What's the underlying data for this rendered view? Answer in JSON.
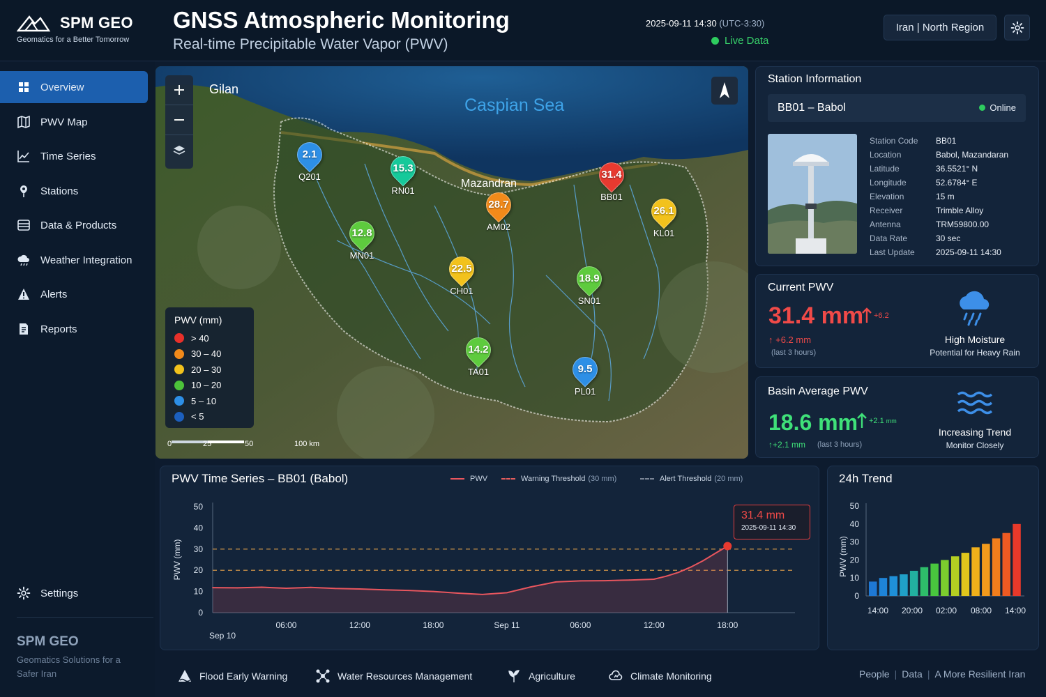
{
  "header": {
    "brand": "SPM GEO",
    "brand_tagline": "Geomatics for a Better Tomorrow",
    "title": "GNSS Atmospheric Monitoring",
    "subtitle": "Real-time Precipitable Water Vapor (PWV)",
    "datetime": "2025-09-11 14:30",
    "timezone": "(UTC-3:30)",
    "live_label": "Live Data",
    "region": "Iran | North Region",
    "settings_icon": "gear-icon"
  },
  "sidebar": {
    "items": [
      {
        "label": "Overview",
        "icon": "overview-icon",
        "active": true
      },
      {
        "label": "PWV Map",
        "icon": "map-icon"
      },
      {
        "label": "Time Series",
        "icon": "chart-line-icon"
      },
      {
        "label": "Stations",
        "icon": "pin-icon"
      },
      {
        "label": "Data & Products",
        "icon": "database-icon"
      },
      {
        "label": "Weather Integration",
        "icon": "cloud-icon"
      },
      {
        "label": "Alerts",
        "icon": "alert-icon"
      },
      {
        "label": "Reports",
        "icon": "report-icon"
      }
    ],
    "settings_label": "Settings",
    "footer_brand": "SPM GEO",
    "footer_text": "Geomatics Solutions for a Safer Iran"
  },
  "map": {
    "labels": {
      "sea": "Caspian Sea",
      "gilan": "Gilan",
      "mazandaran": "Mazandran"
    },
    "stations": [
      {
        "code": "Q201",
        "pwv": "2.1",
        "color": "#2d8fe6"
      },
      {
        "code": "RN01",
        "pwv": "15.3",
        "color": "#16c99a"
      },
      {
        "code": "AM02",
        "pwv": "28.7",
        "color": "#f28a1a"
      },
      {
        "code": "BB01",
        "pwv": "31.4",
        "color": "#e83a30"
      },
      {
        "code": "KL01",
        "pwv": "26.1",
        "color": "#f2c21c"
      },
      {
        "code": "MN01",
        "pwv": "12.8",
        "color": "#5ecb3e"
      },
      {
        "code": "CH01",
        "pwv": "22.5",
        "color": "#f2c21c"
      },
      {
        "code": "SN01",
        "pwv": "18.9",
        "color": "#5ecb3e"
      },
      {
        "code": "TA01",
        "pwv": "14.2",
        "color": "#5ecb3e"
      },
      {
        "code": "PL01",
        "pwv": "9.5",
        "color": "#2d8fe6"
      }
    ],
    "legend": {
      "title": "PWV (mm)",
      "rows": [
        {
          "label": "> 40",
          "color": "#e8302a"
        },
        {
          "label": "30 – 40",
          "color": "#f28a1a"
        },
        {
          "label": "20 – 30",
          "color": "#f2c21c"
        },
        {
          "label": "10 – 20",
          "color": "#4cc23a"
        },
        {
          "label": "5 – 10",
          "color": "#2d8fe6"
        },
        {
          "label": "< 5",
          "color": "#1c5fbd"
        }
      ]
    },
    "scale": {
      "s0": "0",
      "s1": "25",
      "s2": "50",
      "s3": "100 km"
    }
  },
  "station_info": {
    "title": "Station Information",
    "selected": "BB01 – Babol",
    "status": "Online",
    "rows": [
      {
        "k": "Station Code",
        "v": "BB01"
      },
      {
        "k": "Location",
        "v": "Babol, Mazandaran"
      },
      {
        "k": "Latitude",
        "v": "36.5521° N"
      },
      {
        "k": "Longitude",
        "v": "52.6784° E"
      },
      {
        "k": "Elevation",
        "v": "15 m"
      },
      {
        "k": "Receiver",
        "v": "Trimble Alloy"
      },
      {
        "k": "Antenna",
        "v": "TRM59800.00"
      },
      {
        "k": "Data Rate",
        "v": "30 sec"
      },
      {
        "k": "Last Update",
        "v": "2025-09-11 14:30"
      }
    ]
  },
  "current_pwv": {
    "title": "Current PWV",
    "value": "31.4 mm",
    "delta_small": "+6.2",
    "delta": "+6.2 mm",
    "delta_note": "(last 3 hours)",
    "status": "High Moisture",
    "status_note": "Potential for Heavy Rain"
  },
  "basin_pwv": {
    "title": "Basin Average PWV",
    "value": "18.6 mm",
    "delta_small": "+2.1",
    "delta_unit": "mm",
    "delta": "+2.1 mm",
    "delta_note": "(last 3 hours)",
    "status": "Increasing Trend",
    "status_note": "Monitor Closely"
  },
  "time_series": {
    "title": "PWV Time Series – BB01 (Babol)",
    "legend": {
      "pwv": "PWV",
      "warning": "Warning Threshold",
      "warning_val": "(30 mm)",
      "alert": "Alert Threshold",
      "alert_val": "(20 mm)"
    },
    "tooltip_value": "31.4 mm",
    "tooltip_time": "2025-09-11 14:30"
  },
  "chart_data": [
    {
      "type": "line",
      "title": "PWV Time Series – BB01 (Babol)",
      "ylabel": "PWV (mm)",
      "xlabel": "",
      "ylim": [
        0,
        50
      ],
      "yticks": [
        "0",
        "10",
        "20",
        "30",
        "40",
        "50"
      ],
      "xtick_labels": [
        "Sep 10",
        "06:00",
        "12:00",
        "18:00",
        "Sep 11",
        "06:00",
        "12:00",
        "18:00"
      ],
      "xtick_hours": [
        0,
        6,
        12,
        18,
        24,
        30,
        36,
        42
      ],
      "x_hours": [
        0,
        2,
        4,
        6,
        8,
        10,
        12,
        14,
        16,
        18,
        20,
        22,
        24,
        26,
        28,
        30,
        32,
        34,
        36,
        37,
        38,
        39,
        40,
        41,
        42
      ],
      "series": [
        {
          "name": "PWV",
          "values": [
            11.8,
            11.7,
            12.0,
            11.5,
            11.9,
            11.4,
            11.2,
            10.8,
            10.5,
            10.0,
            9.2,
            8.6,
            9.4,
            12.2,
            14.5,
            15.0,
            15.1,
            15.4,
            15.8,
            17.2,
            19.0,
            21.5,
            24.5,
            28.0,
            31.4
          ]
        }
      ],
      "thresholds": [
        {
          "name": "Warning Threshold",
          "value": 30
        },
        {
          "name": "Alert Threshold",
          "value": 20
        }
      ],
      "grid": false
    },
    {
      "type": "bar",
      "title": "24h Trend",
      "ylabel": "PWV (mm)",
      "ylim": [
        0,
        50
      ],
      "yticks": [
        "0",
        "10",
        "20",
        "30",
        "40",
        "50"
      ],
      "xtick_labels": [
        "14:00",
        "20:00",
        "02:00",
        "08:00",
        "14:00"
      ],
      "values": [
        8,
        10,
        11,
        12,
        14,
        16,
        18,
        20,
        22,
        24,
        27,
        29,
        32,
        35,
        40
      ],
      "colors": [
        "#1e78d4",
        "#1e84d8",
        "#1f90d8",
        "#20a0c8",
        "#22b0a0",
        "#2ebd6a",
        "#49c63e",
        "#7ccc2e",
        "#b4cf22",
        "#e0c61c",
        "#f0b01a",
        "#f29a1c",
        "#f27e1c",
        "#ee5a22",
        "#e8392a"
      ]
    }
  ],
  "trend": {
    "title": "24h Trend"
  },
  "bottom": {
    "items": [
      {
        "label": "Flood Early Warning",
        "icon": "warning-triangle-icon"
      },
      {
        "label": "Water Resources Management",
        "icon": "network-icon"
      },
      {
        "label": "Agriculture",
        "icon": "leaf-icon"
      },
      {
        "label": "Climate Monitoring",
        "icon": "climate-icon"
      }
    ],
    "links": [
      "People",
      "Data",
      "A More Resilient Iran"
    ]
  }
}
